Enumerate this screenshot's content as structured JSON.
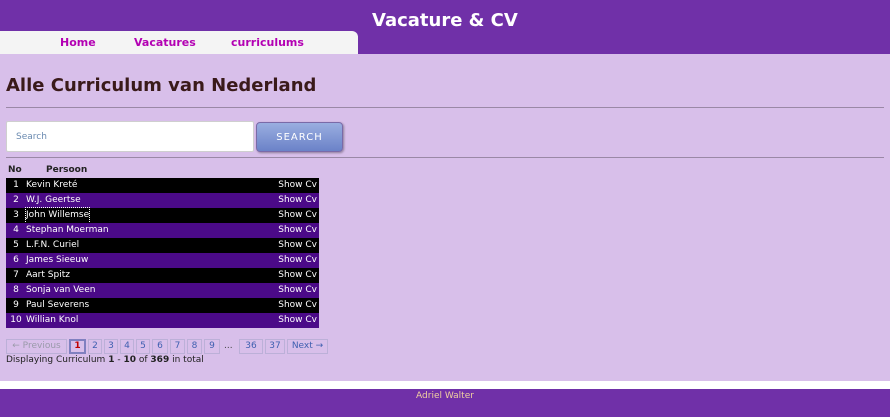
{
  "header": {
    "title": "Vacature & CV",
    "nav": [
      {
        "label": "Home"
      },
      {
        "label": "Vacatures"
      },
      {
        "label": "curriculums"
      }
    ]
  },
  "main": {
    "title": "Alle Curriculum van Nederland",
    "search": {
      "placeholder": "Search",
      "value": "",
      "button_label": "SEARCH"
    },
    "table": {
      "columns": [
        "No",
        "Persoon"
      ],
      "action_label": "Show Cv",
      "rows": [
        {
          "no": "1",
          "name": "Kevin Kreté"
        },
        {
          "no": "2",
          "name": "W.J. Geertse"
        },
        {
          "no": "3",
          "name": "John Willemse"
        },
        {
          "no": "4",
          "name": "Stephan Moerman"
        },
        {
          "no": "5",
          "name": "L.F.N. Curiel"
        },
        {
          "no": "6",
          "name": "James Sieeuw"
        },
        {
          "no": "7",
          "name": "Aart Spitz"
        },
        {
          "no": "8",
          "name": "Sonja van Veen"
        },
        {
          "no": "9",
          "name": "Paul Severens"
        },
        {
          "no": "10",
          "name": "Willian Knol"
        }
      ]
    },
    "pagination": {
      "previous": "← Previous",
      "pages": [
        "1",
        "2",
        "3",
        "4",
        "5",
        "6",
        "7",
        "8",
        "9"
      ],
      "current": "1",
      "ellipsis": "...",
      "last_pages": [
        "36",
        "37"
      ],
      "next": "Next →"
    },
    "summary": {
      "prefix": "Displaying Curriculum",
      "from": "1",
      "dash": "-",
      "to": "10",
      "of": "of",
      "total": "369",
      "suffix": "in total"
    }
  },
  "footer": {
    "text": "Adriel Walter"
  },
  "colors": {
    "header": "#7030a8",
    "content_bg": "#d8bfea",
    "row_dark": "#000000",
    "row_purple": "#4b0a88",
    "nav_link": "#b300b3"
  }
}
